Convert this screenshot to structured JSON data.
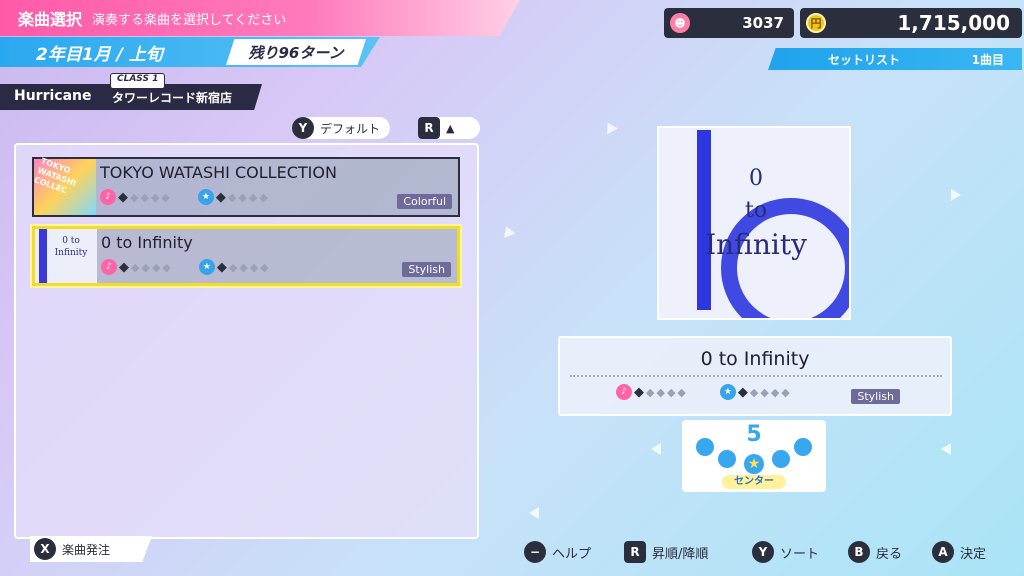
{
  "header": {
    "title": "楽曲選択",
    "subtitle": "演奏する楽曲を選択してください",
    "date": "2年目1月 / 上旬",
    "turns": "残り96ターン",
    "unit_name": "Hurricane",
    "class_label": "CLASS 1",
    "venue": "タワーレコード新宿店"
  },
  "currency": {
    "fans": "3037",
    "money": "1,715,000",
    "fan_icon": "smile-icon",
    "money_icon": "coin-icon"
  },
  "setlist": {
    "label": "セットリスト",
    "count": "1曲目"
  },
  "sort": {
    "default_key": "Y",
    "default_label": "デフォルト",
    "order_key": "R",
    "order_icon": "▲"
  },
  "songs": [
    {
      "title": "TOKYO WATASHI COLLECTION",
      "style": "Colorful",
      "vocal_level": 1,
      "dance_level": 1,
      "thumb_text": "TOKYO WATASHI COLLEC",
      "selected": false
    },
    {
      "title": "0 to Infinity",
      "style": "Stylish",
      "vocal_level": 1,
      "dance_level": 1,
      "thumb_text": "0 to Infinity",
      "selected": true
    }
  ],
  "order": {
    "key": "X",
    "label": "楽曲発注"
  },
  "detail": {
    "jacket_line1": "0",
    "jacket_line2": "to",
    "jacket_line3": "Infinity",
    "title": "0 to Infinity",
    "style": "Stylish",
    "vocal_level": 1,
    "dance_level": 1,
    "position_number": "5",
    "position_label": "センター"
  },
  "guide": [
    {
      "key": "−",
      "label": "ヘルプ",
      "shape": "round"
    },
    {
      "key": "R",
      "label": "昇順/降順",
      "shape": "square"
    },
    {
      "key": "Y",
      "label": "ソート",
      "shape": "round"
    },
    {
      "key": "B",
      "label": "戻る",
      "shape": "round"
    },
    {
      "key": "A",
      "label": "決定",
      "shape": "round"
    }
  ],
  "colors": {
    "accent_pink": "#ff5aa8",
    "accent_blue": "#2aa8ef",
    "dark": "#2b2f3d",
    "selected_border": "#f2dc2a"
  }
}
